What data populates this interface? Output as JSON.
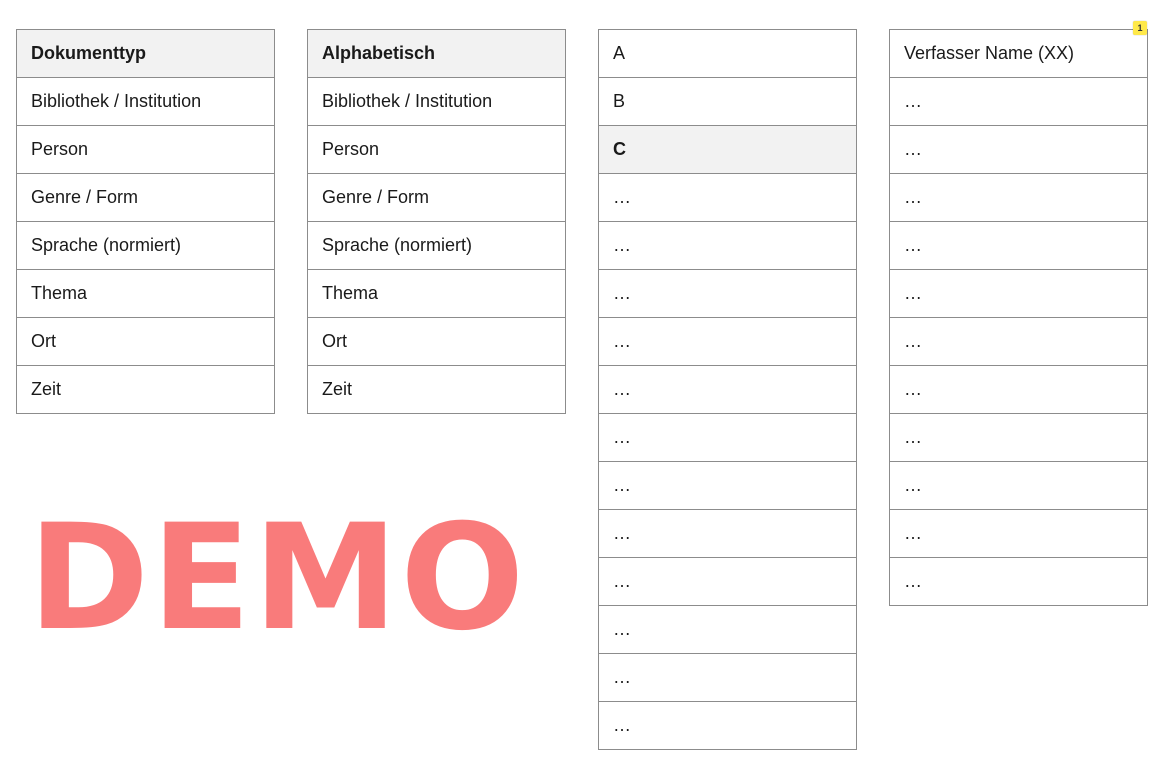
{
  "columns": [
    {
      "name": "dokumenttyp",
      "cells": [
        {
          "label": "Dokumenttyp",
          "active": true
        },
        {
          "label": "Bibliothek / Institution",
          "active": false
        },
        {
          "label": "Person",
          "active": false
        },
        {
          "label": "Genre / Form",
          "active": false
        },
        {
          "label": "Sprache (normiert)",
          "active": false
        },
        {
          "label": "Thema",
          "active": false
        },
        {
          "label": "Ort",
          "active": false
        },
        {
          "label": "Zeit",
          "active": false
        }
      ]
    },
    {
      "name": "alphabetisch",
      "cells": [
        {
          "label": "Alphabetisch",
          "active": true
        },
        {
          "label": "Bibliothek / Institution",
          "active": false
        },
        {
          "label": "Person",
          "active": false
        },
        {
          "label": "Genre / Form",
          "active": false
        },
        {
          "label": "Sprache (normiert)",
          "active": false
        },
        {
          "label": "Thema",
          "active": false
        },
        {
          "label": "Ort",
          "active": false
        },
        {
          "label": "Zeit",
          "active": false
        }
      ]
    },
    {
      "name": "letters",
      "cells": [
        {
          "label": "A",
          "active": false
        },
        {
          "label": "B",
          "active": false
        },
        {
          "label": "C",
          "active": true
        },
        {
          "label": "…",
          "active": false
        },
        {
          "label": "…",
          "active": false
        },
        {
          "label": "…",
          "active": false
        },
        {
          "label": "…",
          "active": false
        },
        {
          "label": "…",
          "active": false
        },
        {
          "label": "…",
          "active": false
        },
        {
          "label": "…",
          "active": false
        },
        {
          "label": "…",
          "active": false
        },
        {
          "label": "…",
          "active": false
        },
        {
          "label": "…",
          "active": false
        },
        {
          "label": "…",
          "active": false
        },
        {
          "label": "…",
          "active": false
        }
      ]
    },
    {
      "name": "authors",
      "cells": [
        {
          "label": "Verfasser Name (XX)",
          "active": false
        },
        {
          "label": "…",
          "active": false
        },
        {
          "label": "…",
          "active": false
        },
        {
          "label": "…",
          "active": false
        },
        {
          "label": "…",
          "active": false
        },
        {
          "label": "…",
          "active": false
        },
        {
          "label": "…",
          "active": false
        },
        {
          "label": "…",
          "active": false
        },
        {
          "label": "…",
          "active": false
        },
        {
          "label": "…",
          "active": false
        },
        {
          "label": "…",
          "active": false
        },
        {
          "label": "…",
          "active": false
        }
      ]
    }
  ],
  "watermark": "DEMO",
  "note_badge": "1",
  "colors": {
    "watermark": "#f97b7b",
    "active_cell_bg": "#f2f2f2",
    "border": "#8c8c8c",
    "badge": "#ffe94a"
  }
}
